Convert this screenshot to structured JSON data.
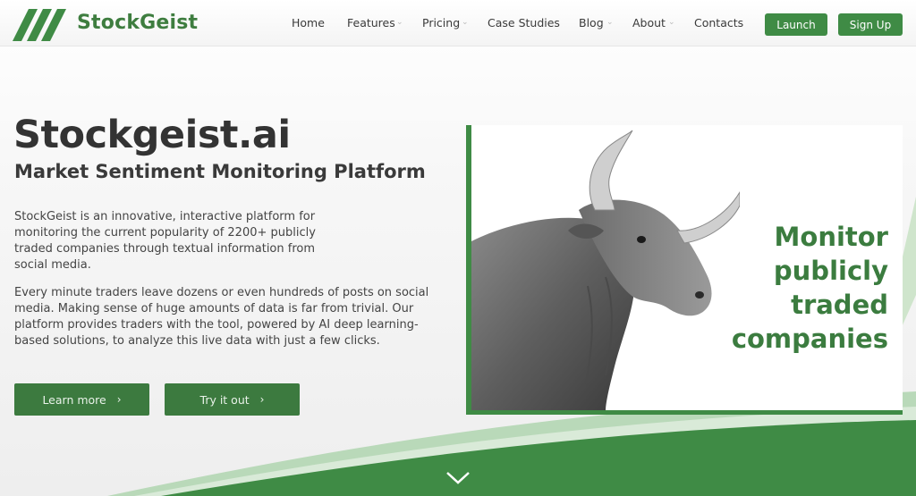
{
  "brand": {
    "name": "StockGeist"
  },
  "nav": {
    "items": [
      {
        "label": "Home",
        "has_dropdown": false
      },
      {
        "label": "Features",
        "has_dropdown": true
      },
      {
        "label": "Pricing",
        "has_dropdown": true
      },
      {
        "label": "Case Studies",
        "has_dropdown": false
      },
      {
        "label": "Blog",
        "has_dropdown": true
      },
      {
        "label": "About",
        "has_dropdown": true
      },
      {
        "label": "Contacts",
        "has_dropdown": false
      }
    ],
    "launch_label": "Launch",
    "signup_label": "Sign Up"
  },
  "hero": {
    "title": "Stockgeist.ai",
    "subtitle": "Market Sentiment Monitoring Platform",
    "paragraph1": "StockGeist is an innovative, interactive platform for monitoring the current popularity of 2200+ publicly traded companies through textual information from social media.",
    "paragraph2": "Every minute traders leave dozens or even hundreds of posts on social media. Making sense of huge amounts of data is far from trivial. Our platform provides traders with the tool, powered by AI deep learning-based solutions, to analyze this live data with just a few clicks.",
    "learn_more_label": "Learn more",
    "try_it_label": "Try it out",
    "chevron": "›"
  },
  "card": {
    "line1": "Monitor",
    "line2": "publicly",
    "line3": "traded",
    "line4": "companies",
    "image": "bull-photo"
  },
  "icons": {
    "caret": "caret-down-icon",
    "scroll": "chevron-down-icon"
  },
  "colors": {
    "brand_green": "#3f8b45",
    "dark_green": "#3c7a3f",
    "text": "#333333"
  }
}
